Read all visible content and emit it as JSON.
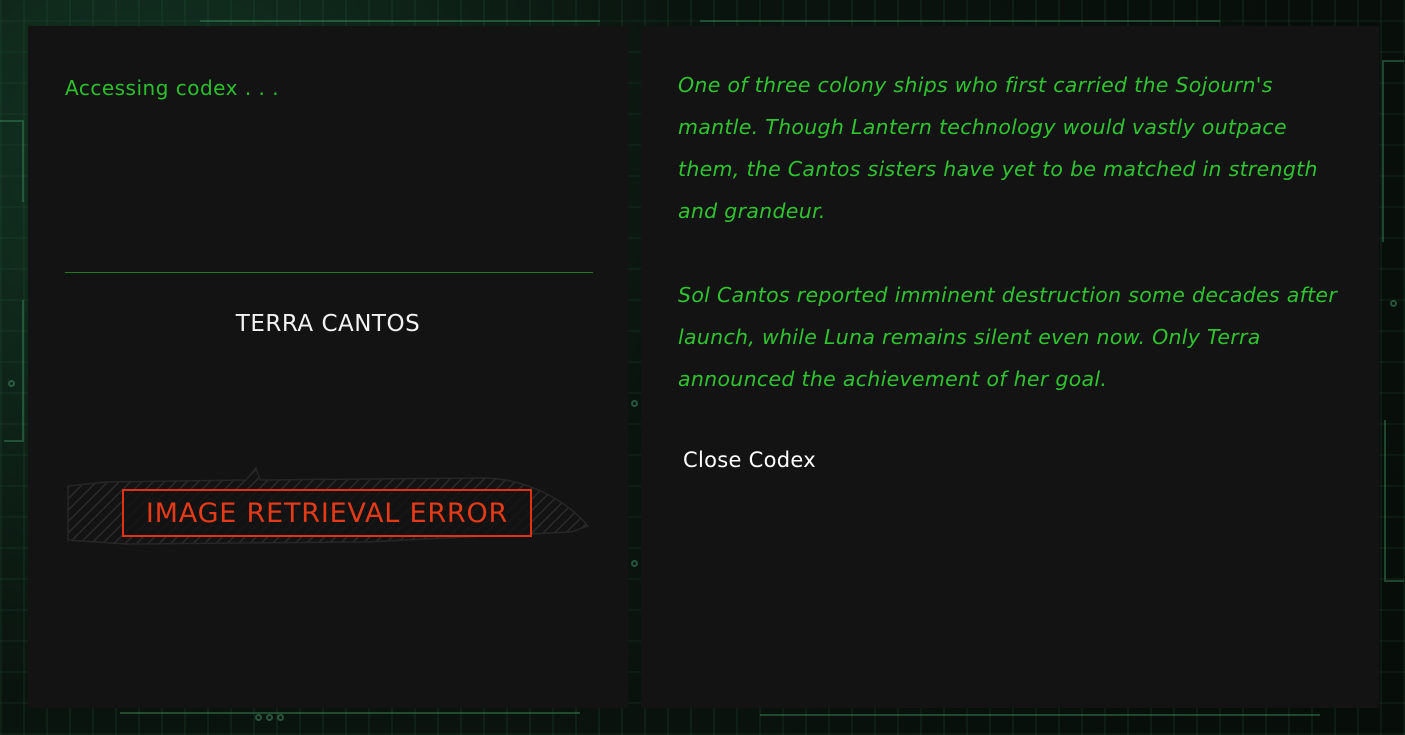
{
  "codex": {
    "status_text": "Accessing codex . . .",
    "ship_name": "TERRA CANTOS",
    "image_error": "IMAGE RETRIEVAL ERROR",
    "description": [
      "One of three colony ships who first carried the Sojourn's mantle. Though Lantern technology would vastly outpace them, the Cantos sisters have yet to be matched in strength and grandeur.",
      "Sol Cantos reported imminent destruction some decades after launch, while Luna remains silent even now. Only Terra announced the achievement of her goal."
    ],
    "close_label": "Close Codex"
  },
  "colors": {
    "accent_green": "#2fc42f",
    "error_red": "#e53a18",
    "panel_bg": "#131313"
  }
}
